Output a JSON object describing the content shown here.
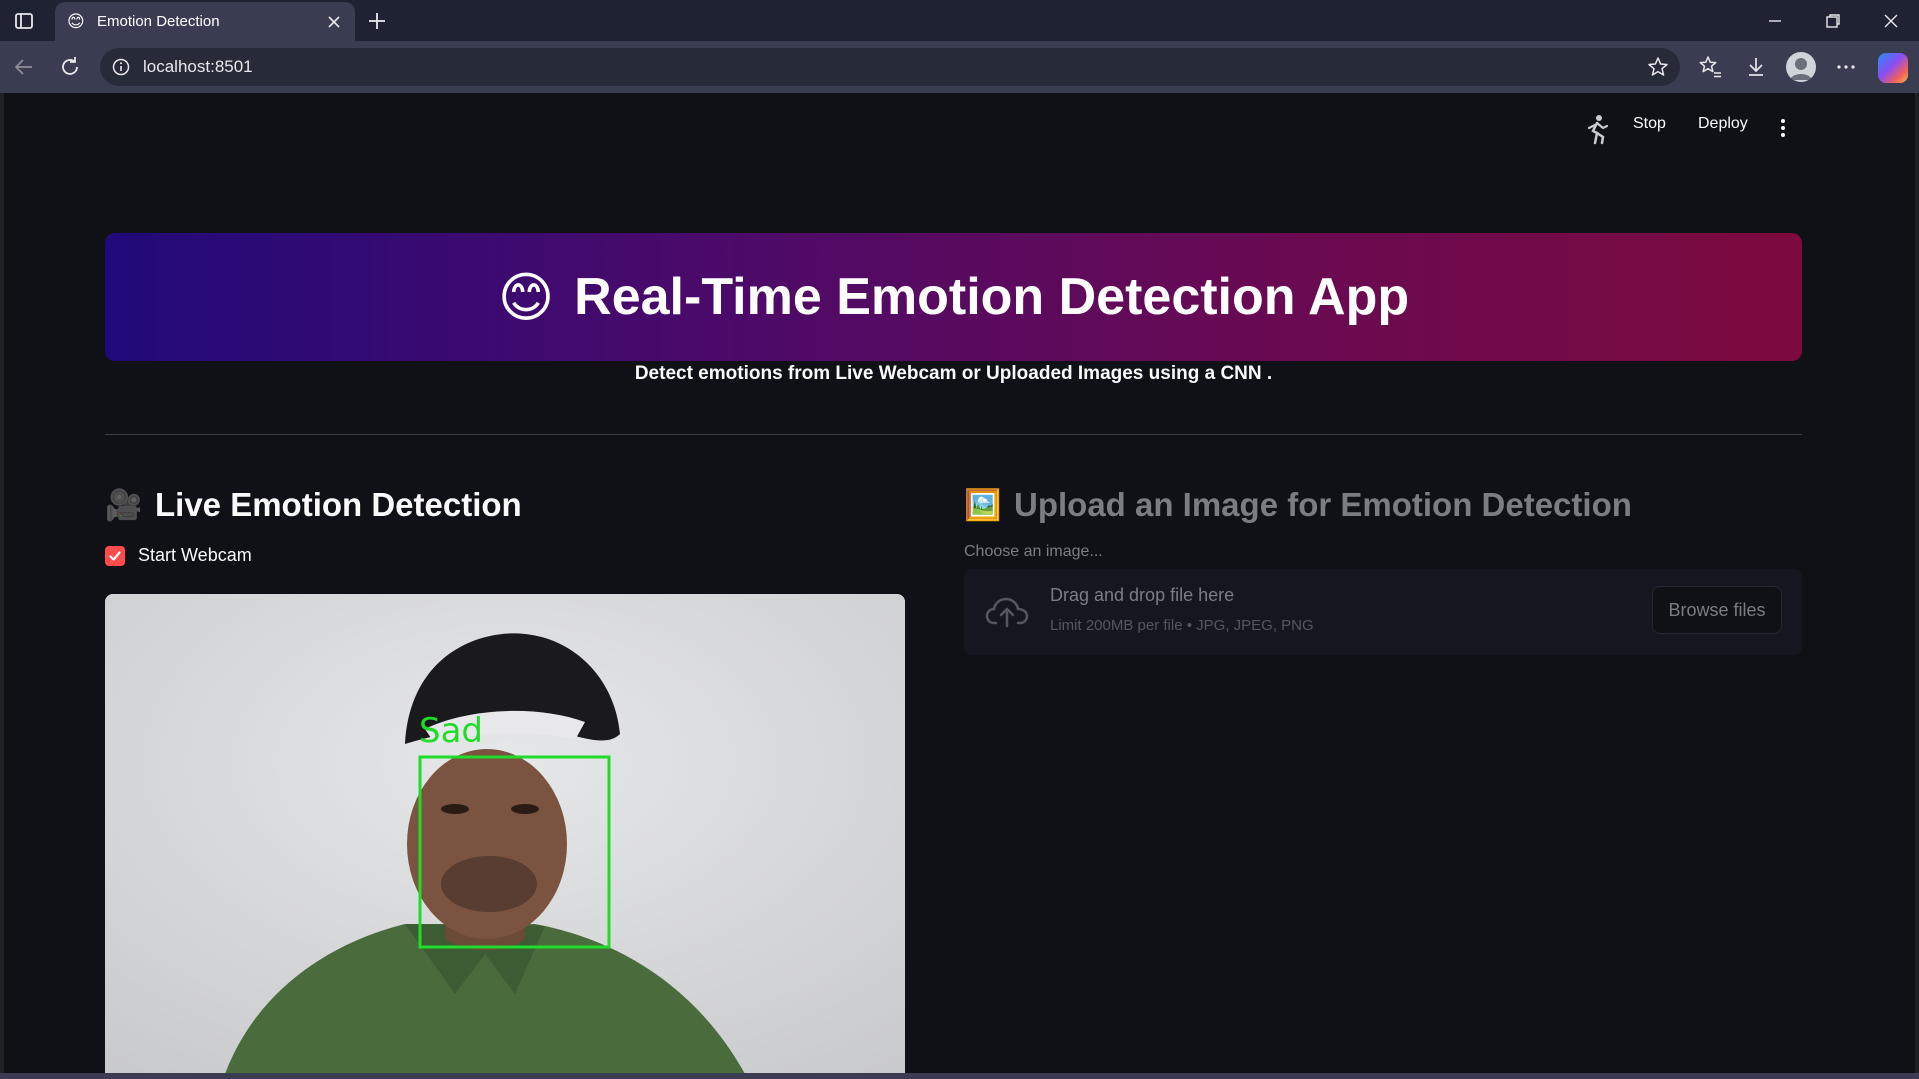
{
  "browser": {
    "tab_title": "Emotion Detection",
    "tab_favicon": "😊",
    "url": "localhost:8501",
    "colors": {
      "tabbar": "#1f2233",
      "toolbar": "#3a3d51"
    }
  },
  "header": {
    "stop_label": "Stop",
    "deploy_label": "Deploy"
  },
  "banner": {
    "emoji": "😊",
    "title": "Real-Time Emotion Detection App",
    "gradient": [
      "#210a7a",
      "#7c0a3e"
    ]
  },
  "subtitle": "Detect emotions from Live Webcam or Uploaded Images using a CNN .",
  "live": {
    "icon": "🎥",
    "title": "Live Emotion Detection",
    "checkbox_label": "Start Webcam",
    "checkbox_checked": true,
    "detected_emotion": "Sad",
    "box_color": "#1fdc2a"
  },
  "upload": {
    "icon": "🖼️",
    "title": "Upload an Image for Emotion Detection",
    "label": "Choose an image...",
    "drop_title": "Drag and drop file here",
    "drop_subtitle": "Limit 200MB per file • JPG, JPEG, PNG",
    "browse_label": "Browse files"
  },
  "accent_color": "#ff4b4b"
}
